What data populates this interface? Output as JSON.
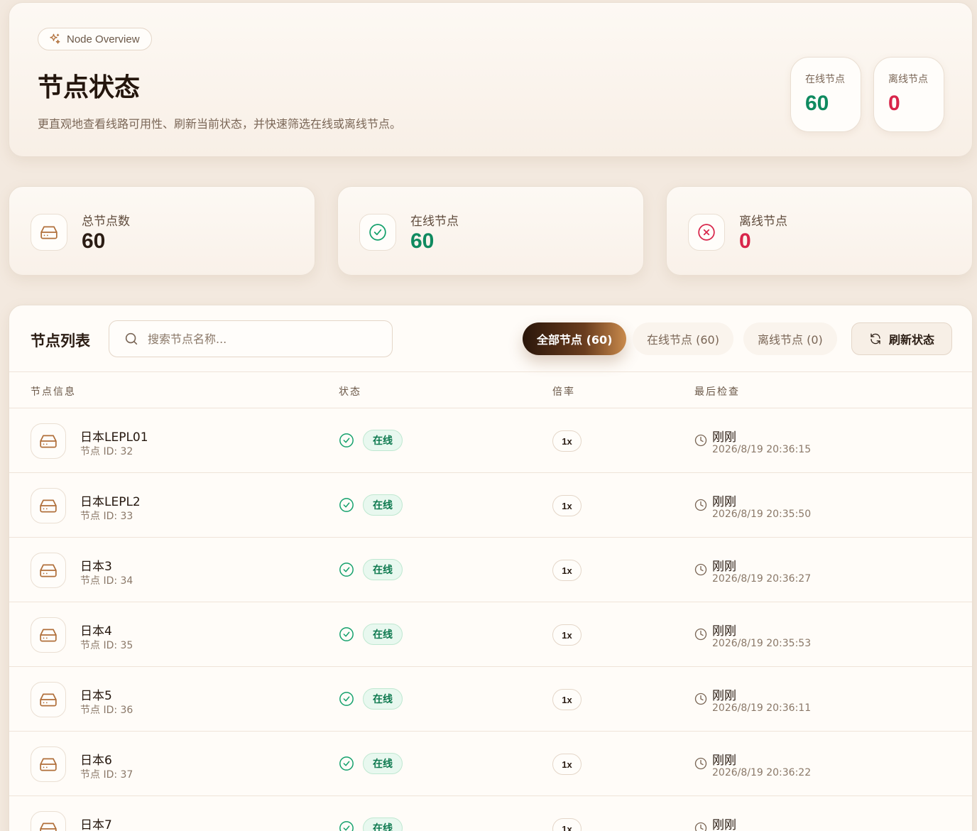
{
  "header": {
    "pill_label": "Node Overview",
    "title": "节点状态",
    "description": "更直观地查看线路可用性、刷新当前状态，并快速筛选在线或离线节点。",
    "online_label": "在线节点",
    "online_value": "60",
    "offline_label": "离线节点",
    "offline_value": "0"
  },
  "stats": {
    "total_label": "总节点数",
    "total_value": "60",
    "online_label": "在线节点",
    "online_value": "60",
    "offline_label": "离线节点",
    "offline_value": "0"
  },
  "list": {
    "title": "节点列表",
    "search_placeholder": "搜索节点名称...",
    "filters": [
      "全部节点 (60)",
      "在线节点 (60)",
      "离线节点 (0)"
    ],
    "refresh_label": "刷新状态",
    "columns": [
      "节点信息",
      "状态",
      "倍率",
      "最后检查"
    ],
    "rows": [
      {
        "name": "日本LEPL01",
        "id": "节点 ID: 32",
        "status": "在线",
        "rate": "1x",
        "relative": "刚刚",
        "time": "2026/8/19 20:36:15"
      },
      {
        "name": "日本LEPL2",
        "id": "节点 ID: 33",
        "status": "在线",
        "rate": "1x",
        "relative": "刚刚",
        "time": "2026/8/19 20:35:50"
      },
      {
        "name": "日本3",
        "id": "节点 ID: 34",
        "status": "在线",
        "rate": "1x",
        "relative": "刚刚",
        "time": "2026/8/19 20:36:27"
      },
      {
        "name": "日本4",
        "id": "节点 ID: 35",
        "status": "在线",
        "rate": "1x",
        "relative": "刚刚",
        "time": "2026/8/19 20:35:53"
      },
      {
        "name": "日本5",
        "id": "节点 ID: 36",
        "status": "在线",
        "rate": "1x",
        "relative": "刚刚",
        "time": "2026/8/19 20:36:11"
      },
      {
        "name": "日本6",
        "id": "节点 ID: 37",
        "status": "在线",
        "rate": "1x",
        "relative": "刚刚",
        "time": "2026/8/19 20:36:22"
      },
      {
        "name": "日本7",
        "id": "",
        "status": "在线",
        "rate": "1x",
        "relative": "刚刚",
        "time": ""
      }
    ]
  },
  "colors": {
    "accent_brown": "#b06f3a",
    "online_green": "#0f8a5f",
    "offline_red": "#d8254a"
  },
  "icons": {
    "pill": "sparkles-icon",
    "node": "hard-drive-icon",
    "online": "check-circle-icon",
    "offline": "x-circle-icon",
    "search": "search-icon",
    "refresh": "refresh-icon",
    "time": "clock-icon"
  }
}
